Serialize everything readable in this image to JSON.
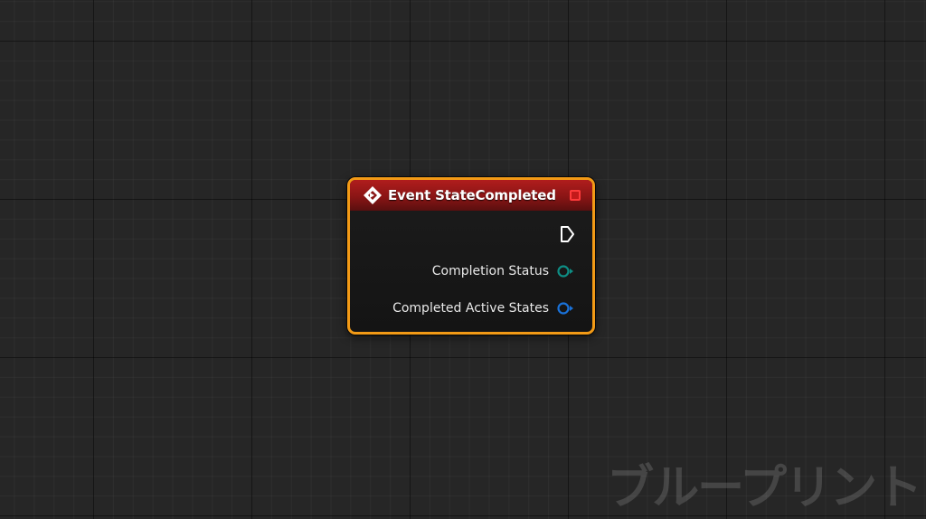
{
  "graph": {
    "watermark": "ブループリント"
  },
  "node": {
    "title": "Event StateCompleted",
    "icon": "event-diamond-icon",
    "header_color": "#9e1a1a",
    "selection_outline_color": "#f29a16",
    "delegate_pin_color": "#ff3b3b",
    "pins": [
      {
        "label": "",
        "type": "exec",
        "color": "#ffffff"
      },
      {
        "label": "Completion Status",
        "type": "byte-enum",
        "color": "#0e8d84"
      },
      {
        "label": "Completed Active States",
        "type": "struct",
        "color": "#1a72d9"
      }
    ]
  }
}
